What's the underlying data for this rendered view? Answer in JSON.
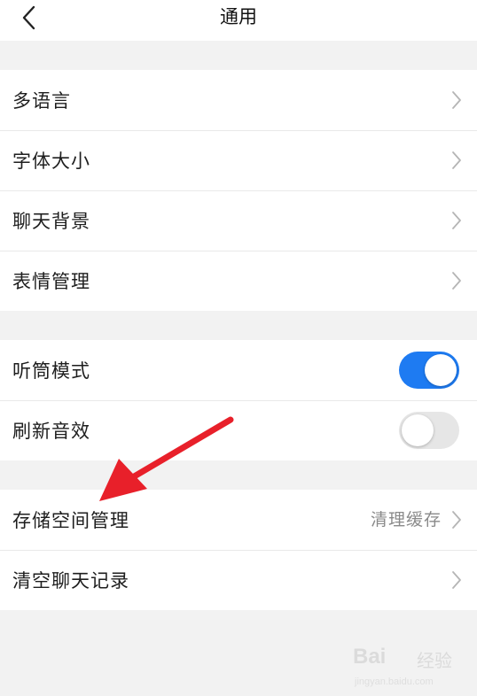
{
  "header": {
    "title": "通用",
    "back_icon": "chevron-left-icon"
  },
  "groups": [
    {
      "items": [
        {
          "label": "多语言",
          "control": "chevron"
        },
        {
          "label": "字体大小",
          "control": "chevron"
        },
        {
          "label": "聊天背景",
          "control": "chevron"
        },
        {
          "label": "表情管理",
          "control": "chevron"
        }
      ]
    },
    {
      "items": [
        {
          "label": "听筒模式",
          "control": "toggle",
          "value": true
        },
        {
          "label": "刷新音效",
          "control": "toggle",
          "value": false
        }
      ]
    },
    {
      "items": [
        {
          "label": "存储空间管理",
          "control": "chevron",
          "aux_text": "清理缓存"
        },
        {
          "label": "清空聊天记录",
          "control": "chevron"
        }
      ]
    }
  ],
  "annotation": {
    "type": "red-arrow",
    "color": "#e8202a",
    "points_to": "存储空间管理"
  },
  "watermark": {
    "logo": "Bai",
    "text": "经验",
    "sub": "jingyan.baidu.com"
  },
  "colors": {
    "toggle_on": "#1e7bf2",
    "toggle_off": "#e6e6e6",
    "background": "#f2f2f2"
  }
}
